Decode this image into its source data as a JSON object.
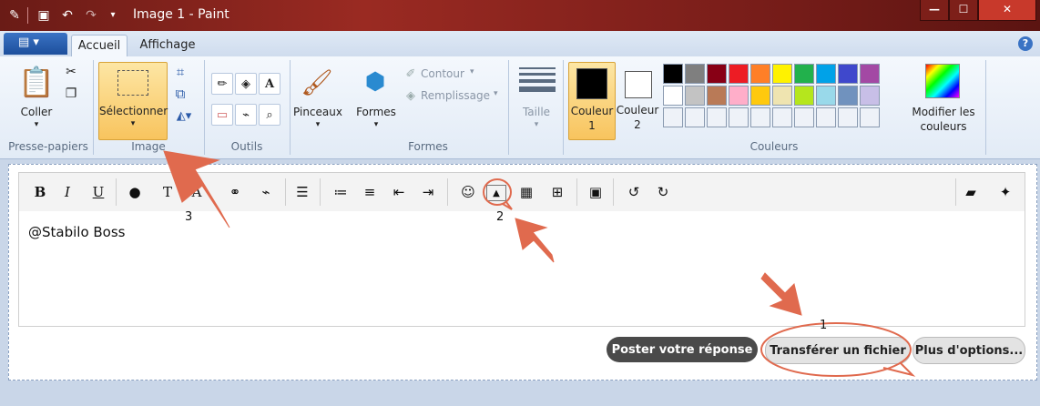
{
  "window": {
    "title": "Image 1 - Paint",
    "minimize_label": "—",
    "maximize_label": "☐",
    "close_label": "✕"
  },
  "menu": {
    "file_label": "▤ ▾",
    "tabs": [
      {
        "label": "Accueil",
        "active": true
      },
      {
        "label": "Affichage",
        "active": false
      }
    ],
    "help_label": "?"
  },
  "ribbon": {
    "clipboard": {
      "paste_label": "Coller",
      "group_label": "Presse-papiers"
    },
    "image": {
      "select_label": "Sélectionner",
      "group_label": "Image"
    },
    "tools": {
      "group_label": "Outils"
    },
    "shapes": {
      "brushes_label": "Pinceaux",
      "shapes_label": "Formes",
      "outline_label": "Contour",
      "fill_label": "Remplissage",
      "group_label": "Formes"
    },
    "size_label": "Taille",
    "colors": {
      "color1_label": "Couleur",
      "color1_num": "1",
      "color2_label": "Couleur",
      "color2_num": "2",
      "edit_label_1": "Modifier les",
      "edit_label_2": "couleurs",
      "group_label": "Couleurs",
      "color1_value": "#000000",
      "color2_value": "#ffffff",
      "palette_row1": [
        "#000000",
        "#7f7f7f",
        "#880015",
        "#ed1c24",
        "#ff7f27",
        "#fff200",
        "#22b14c",
        "#00a2e8",
        "#3f48cc",
        "#a349a4"
      ],
      "palette_row2": [
        "#ffffff",
        "#c3c3c3",
        "#b97a57",
        "#ffaec9",
        "#ffc90e",
        "#efe4b0",
        "#b5e61d",
        "#99d9ea",
        "#7092be",
        "#c8bfe7"
      ]
    }
  },
  "editor": {
    "text": "@Stabilo Boss",
    "toolbar_icons": [
      "bold-icon",
      "italic-icon",
      "underline-icon",
      "color-icon",
      "text-size-icon",
      "font-icon",
      "link-icon",
      "unlink-icon",
      "align-left-icon",
      "bullet-list-icon",
      "numbered-list-icon",
      "outdent-icon",
      "indent-icon",
      "smiley-icon",
      "image-icon",
      "video-icon",
      "add-icon",
      "save-icon",
      "undo-icon",
      "redo-icon",
      "eraser-icon",
      "wrench-icon"
    ]
  },
  "buttons": {
    "post": "Poster votre réponse",
    "upload": "Transférer un fichier",
    "more": "Plus d'options..."
  },
  "annotations": {
    "n1": "1",
    "n2": "2",
    "n3": "3",
    "color": "#e06a4e"
  }
}
